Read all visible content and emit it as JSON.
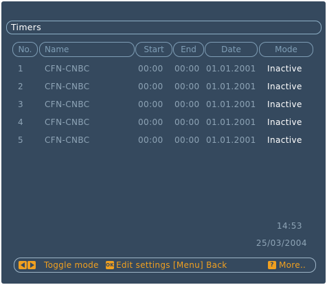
{
  "title": "Timers",
  "columns": {
    "no": "No.",
    "name": "Name",
    "start": "Start",
    "end": "End",
    "date": "Date",
    "mode": "Mode"
  },
  "timers": [
    {
      "no": "1",
      "name": "CFN-CNBC",
      "start": "00:00",
      "end": "00:00",
      "date": "01.01.2001",
      "mode": "Inactive"
    },
    {
      "no": "2",
      "name": "CFN-CNBC",
      "start": "00:00",
      "end": "00:00",
      "date": "01.01.2001",
      "mode": "Inactive"
    },
    {
      "no": "3",
      "name": "CFN-CNBC",
      "start": "00:00",
      "end": "00:00",
      "date": "01.01.2001",
      "mode": "Inactive"
    },
    {
      "no": "4",
      "name": "CFN-CNBC",
      "start": "00:00",
      "end": "00:00",
      "date": "01.01.2001",
      "mode": "Inactive"
    },
    {
      "no": "5",
      "name": "CFN-CNBC",
      "start": "00:00",
      "end": "00:00",
      "date": "01.01.2001",
      "mode": "Inactive"
    }
  ],
  "clock": {
    "time": "14:53",
    "date": "25/03/2004"
  },
  "footer": {
    "toggle_label": "Toggle mode",
    "ok_key": "OK",
    "edit_label": "Edit settings [Menu] Back",
    "more_key": "?",
    "more_label": "More.."
  },
  "colors": {
    "background": "#35495e",
    "accent": "#f0a020",
    "text": "#8ea4b6",
    "highlight": "#ffffff"
  }
}
